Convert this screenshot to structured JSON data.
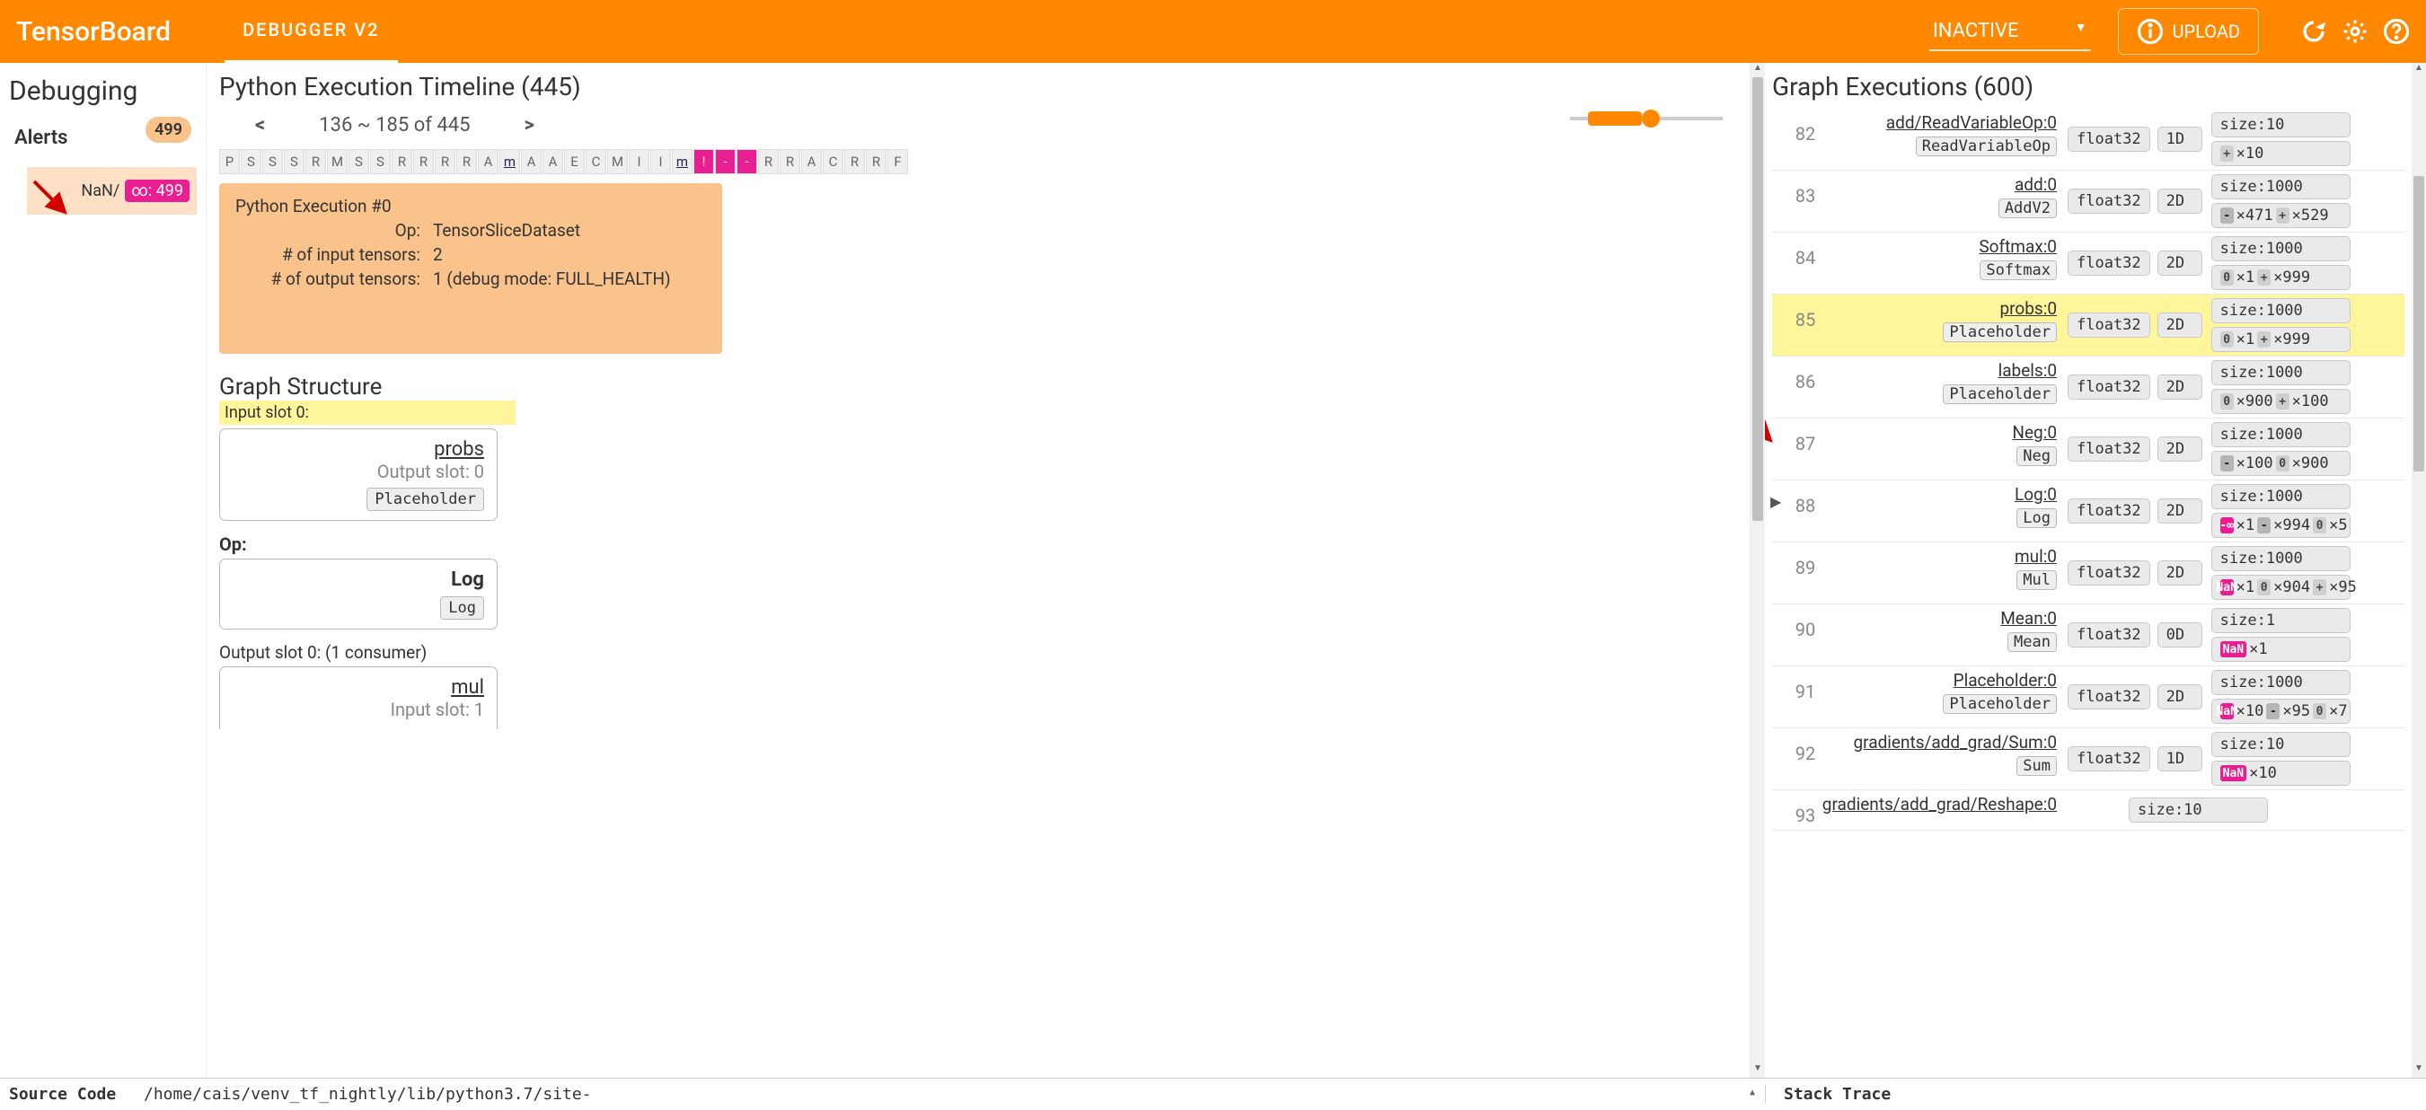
{
  "header": {
    "brand": "TensorBoard",
    "tab": "DEBUGGER V2",
    "run": "INACTIVE",
    "upload": "UPLOAD"
  },
  "alerts": {
    "section": "Debugging",
    "title": "Alerts",
    "total": "499",
    "nan_label": "NaN/",
    "nan_count": "∞: 499"
  },
  "timeline": {
    "title": "Python Execution Timeline (445)",
    "range": "136 ~ 185 of 445",
    "cells": [
      "P",
      "S",
      "S",
      "S",
      "R",
      "M",
      "S",
      "S",
      "R",
      "R",
      "R",
      "R",
      "A",
      "m",
      "A",
      "A",
      "E",
      "C",
      "M",
      "I",
      "I",
      "m",
      "!",
      "-",
      "-",
      "R",
      "R",
      "A",
      "C",
      "R",
      "R",
      "F"
    ],
    "cell_styles": [
      "",
      "",
      "",
      "",
      "",
      "",
      "",
      "",
      "",
      "",
      "",
      "",
      "",
      "u",
      "",
      "",
      "",
      "",
      "",
      "",
      "",
      "u",
      "pink",
      "pink",
      "pink",
      "",
      "",
      "",
      "",
      "",
      "",
      ""
    ],
    "exec": {
      "id": "Python Execution #0",
      "op_lbl": "Op:",
      "op": "TensorSliceDataset",
      "inputs_lbl": "# of input tensors:",
      "inputs": "2",
      "outputs_lbl": "# of output tensors:",
      "outputs": "1   (debug mode: FULL_HEALTH)"
    }
  },
  "graph_structure": {
    "title": "Graph Structure",
    "input_slot": "Input slot 0:",
    "probs": {
      "name": "probs",
      "sub": "Output slot: 0",
      "op": "Placeholder"
    },
    "op_label": "Op:",
    "op": {
      "name": "Log",
      "op": "Log"
    },
    "output_slot": "Output slot 0: (1 consumer)",
    "mul": {
      "name": "mul",
      "sub": "Input slot: 1"
    }
  },
  "graph_exec": {
    "title": "Graph Executions (600)",
    "rows": [
      {
        "i": "82",
        "name": "add/ReadVariableOp:0",
        "op": "ReadVariableOp",
        "dt": "float32",
        "sh": "1D",
        "sz": "size:10",
        "br": [
          [
            "+",
            "×10"
          ]
        ]
      },
      {
        "i": "83",
        "name": "add:0",
        "op": "AddV2",
        "dt": "float32",
        "sh": "2D",
        "sz": "size:1000",
        "br": [
          [
            "-",
            "×471"
          ],
          [
            "+",
            "×529"
          ]
        ]
      },
      {
        "i": "84",
        "name": "Softmax:0",
        "op": "Softmax",
        "dt": "float32",
        "sh": "2D",
        "sz": "size:1000",
        "br": [
          [
            "0",
            "×1"
          ],
          [
            "+",
            "×999"
          ]
        ]
      },
      {
        "i": "85",
        "hl": true,
        "name": "probs:0",
        "op": "Placeholder",
        "dt": "float32",
        "sh": "2D",
        "sz": "size:1000",
        "br": [
          [
            "0",
            "×1"
          ],
          [
            "+",
            "×999"
          ]
        ]
      },
      {
        "i": "86",
        "name": "labels:0",
        "op": "Placeholder",
        "dt": "float32",
        "sh": "2D",
        "sz": "size:1000",
        "br": [
          [
            "0",
            "×900"
          ],
          [
            "+",
            "×100"
          ]
        ]
      },
      {
        "i": "87",
        "name": "Neg:0",
        "op": "Neg",
        "dt": "float32",
        "sh": "2D",
        "sz": "size:1000",
        "br": [
          [
            "-",
            "×100"
          ],
          [
            "0",
            "×900"
          ]
        ]
      },
      {
        "i": "88",
        "caret": true,
        "name": "Log:0",
        "op": "Log",
        "dt": "float32",
        "sh": "2D",
        "sz": "size:1000",
        "br": [
          [
            "-∞",
            "×1"
          ],
          [
            "-",
            "×994"
          ],
          [
            "0",
            "×5"
          ]
        ]
      },
      {
        "i": "89",
        "name": "mul:0",
        "op": "Mul",
        "dt": "float32",
        "sh": "2D",
        "sz": "size:1000",
        "br": [
          [
            "NaN",
            "×1"
          ],
          [
            "0",
            "×904"
          ],
          [
            "+",
            "×95"
          ]
        ]
      },
      {
        "i": "90",
        "name": "Mean:0",
        "op": "Mean",
        "dt": "float32",
        "sh": "0D",
        "sz": "size:1",
        "br": [
          [
            "NaN",
            "×1"
          ]
        ]
      },
      {
        "i": "91",
        "name": "Placeholder:0",
        "op": "Placeholder",
        "dt": "float32",
        "sh": "2D",
        "sz": "size:1000",
        "br": [
          [
            "NaN",
            "×10"
          ],
          [
            "-",
            "×95"
          ],
          [
            "0",
            "×7"
          ]
        ]
      },
      {
        "i": "92",
        "name": "gradients/add_grad/Sum:0",
        "op": "Sum",
        "dt": "float32",
        "sh": "1D",
        "sz": "size:10",
        "br": [
          [
            "NaN",
            "×10"
          ]
        ]
      },
      {
        "i": "93",
        "name": "gradients/add_grad/Reshape:0",
        "op": "",
        "dt": "",
        "sh": "",
        "sz": "size:10",
        "br": []
      }
    ]
  },
  "footer": {
    "source": "Source Code",
    "path": "/home/cais/venv_tf_nightly/lib/python3.7/site-",
    "stack": "Stack Trace"
  }
}
